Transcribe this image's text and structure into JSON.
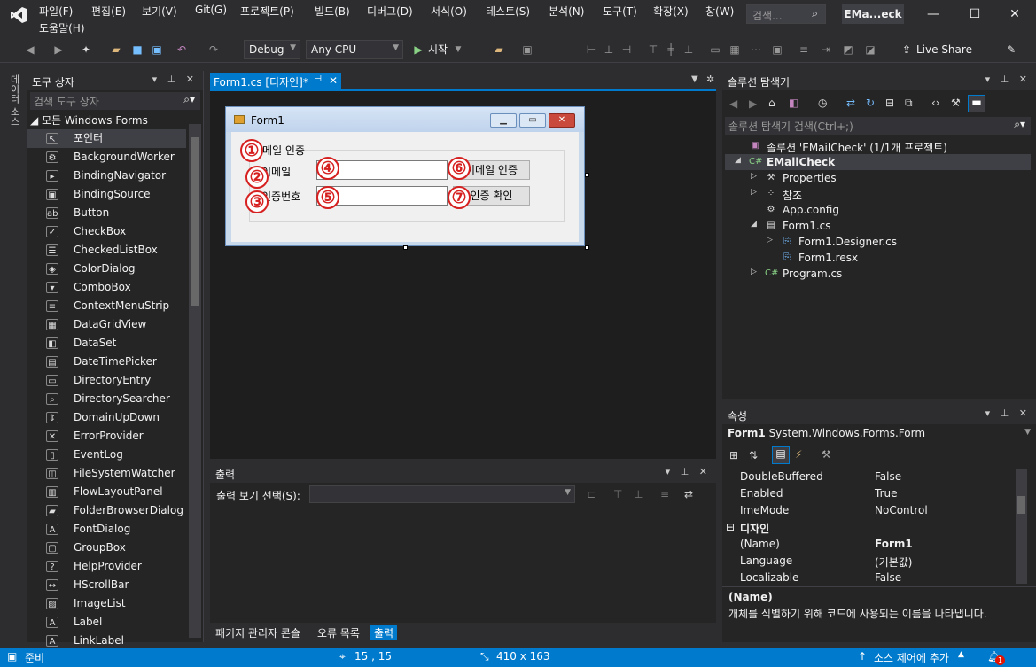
{
  "menu": {
    "items": [
      "파일(F)",
      "편집(E)",
      "보기(V)",
      "Git(G)",
      "프로젝트(P)",
      "빌드(B)",
      "디버그(D)",
      "서식(O)",
      "테스트(S)",
      "분석(N)",
      "도구(T)",
      "확장(X)",
      "창(W)"
    ],
    "help": "도움말(H)",
    "search_placeholder": "검색...",
    "title": "EMa...eck"
  },
  "toolbar": {
    "config": "Debug",
    "platform": "Any CPU",
    "start": "시작",
    "liveshare": "Live Share"
  },
  "left_rail": {
    "label": "데이터 소스"
  },
  "toolbox": {
    "title": "도구 상자",
    "search_placeholder": "검색 도구 상자",
    "group": "모든 Windows Forms",
    "items": [
      {
        "label": "포인터",
        "icon": "pointer-icon",
        "glyph": "↖"
      },
      {
        "label": "BackgroundWorker",
        "icon": "background-worker-icon",
        "glyph": "⚙"
      },
      {
        "label": "BindingNavigator",
        "icon": "binding-navigator-icon",
        "glyph": "▸"
      },
      {
        "label": "BindingSource",
        "icon": "binding-source-icon",
        "glyph": "▣"
      },
      {
        "label": "Button",
        "icon": "button-icon",
        "glyph": "ab"
      },
      {
        "label": "CheckBox",
        "icon": "checkbox-icon",
        "glyph": "✓"
      },
      {
        "label": "CheckedListBox",
        "icon": "checked-listbox-icon",
        "glyph": "☰"
      },
      {
        "label": "ColorDialog",
        "icon": "color-dialog-icon",
        "glyph": "◈"
      },
      {
        "label": "ComboBox",
        "icon": "combobox-icon",
        "glyph": "▾"
      },
      {
        "label": "ContextMenuStrip",
        "icon": "context-menu-icon",
        "glyph": "≡"
      },
      {
        "label": "DataGridView",
        "icon": "datagridview-icon",
        "glyph": "▦"
      },
      {
        "label": "DataSet",
        "icon": "dataset-icon",
        "glyph": "◧"
      },
      {
        "label": "DateTimePicker",
        "icon": "datetimepicker-icon",
        "glyph": "▤"
      },
      {
        "label": "DirectoryEntry",
        "icon": "directory-entry-icon",
        "glyph": "▭"
      },
      {
        "label": "DirectorySearcher",
        "icon": "directory-searcher-icon",
        "glyph": "⌕"
      },
      {
        "label": "DomainUpDown",
        "icon": "domain-updown-icon",
        "glyph": "⇕"
      },
      {
        "label": "ErrorProvider",
        "icon": "error-provider-icon",
        "glyph": "✕"
      },
      {
        "label": "EventLog",
        "icon": "eventlog-icon",
        "glyph": "▯"
      },
      {
        "label": "FileSystemWatcher",
        "icon": "filesystem-watcher-icon",
        "glyph": "◫"
      },
      {
        "label": "FlowLayoutPanel",
        "icon": "flowlayout-icon",
        "glyph": "▥"
      },
      {
        "label": "FolderBrowserDialog",
        "icon": "folder-browser-icon",
        "glyph": "▰"
      },
      {
        "label": "FontDialog",
        "icon": "font-dialog-icon",
        "glyph": "A"
      },
      {
        "label": "GroupBox",
        "icon": "groupbox-icon",
        "glyph": "▢"
      },
      {
        "label": "HelpProvider",
        "icon": "help-provider-icon",
        "glyph": "?"
      },
      {
        "label": "HScrollBar",
        "icon": "hscrollbar-icon",
        "glyph": "↔"
      },
      {
        "label": "ImageList",
        "icon": "imagelist-icon",
        "glyph": "▨"
      },
      {
        "label": "Label",
        "icon": "label-icon",
        "glyph": "A"
      },
      {
        "label": "LinkLabel",
        "icon": "linklabel-icon",
        "glyph": "A"
      }
    ]
  },
  "designer": {
    "tab": "Form1.cs [디자인]*",
    "form_title": "Form1",
    "group_label": "이메일 인증",
    "label_email": "이메일",
    "label_code": "인증번호",
    "btn_email_auth": "이메일 인증",
    "btn_confirm": "인증 확인",
    "markers": [
      "①",
      "②",
      "③",
      "④",
      "⑤",
      "⑥",
      "⑦"
    ]
  },
  "output": {
    "title": "출력",
    "show_label": "출력 보기 선택(S):",
    "tabs": [
      "패키지 관리자 콘솔",
      "오류 목록",
      "출력"
    ]
  },
  "solution": {
    "title": "솔루션 탐색기",
    "search_placeholder": "솔루션 탐색기 검색(Ctrl+;)",
    "items": [
      {
        "label": "솔루션 'EMailCheck' (1/1개 프로젝트)"
      },
      {
        "label": "EMailCheck"
      },
      {
        "label": "Properties"
      },
      {
        "label": "참조"
      },
      {
        "label": "App.config"
      },
      {
        "label": "Form1.cs"
      },
      {
        "label": "Form1.Designer.cs"
      },
      {
        "label": "Form1.resx"
      },
      {
        "label": "Program.cs"
      }
    ]
  },
  "properties": {
    "title": "속성",
    "object": "Form1",
    "object_type": "System.Windows.Forms.Form",
    "rows": [
      {
        "name": "DoubleBuffered",
        "value": "False"
      },
      {
        "name": "Enabled",
        "value": "True"
      },
      {
        "name": "ImeMode",
        "value": "NoControl"
      }
    ],
    "category": "디자인",
    "rows2": [
      {
        "name": "(Name)",
        "value": "Form1"
      },
      {
        "name": "Language",
        "value": "(기본값)"
      },
      {
        "name": "Localizable",
        "value": "False"
      }
    ],
    "desc_title": "(Name)",
    "desc_text": "개체를 식별하기 위해 코드에 사용되는 이름을 나타냅니다."
  },
  "status": {
    "ready": "준비",
    "position": "15 , 15",
    "size": "410 x 163",
    "source_control": "소스 제어에 추가",
    "notifications": "1"
  }
}
